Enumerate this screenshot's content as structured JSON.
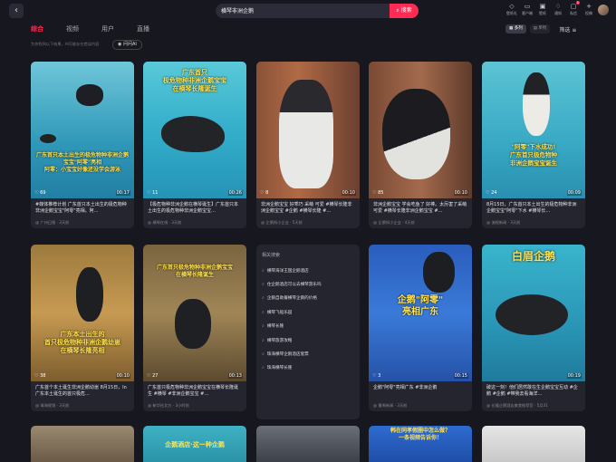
{
  "search": {
    "query": "横琴非洲企鹅",
    "button": "搜索"
  },
  "toolbar": [
    {
      "icon": "diamond-icon",
      "label": "壁纸礼"
    },
    {
      "icon": "devices-icon",
      "label": "客户端"
    },
    {
      "icon": "desktop-icon",
      "label": "壁纸"
    },
    {
      "icon": "notify-icon",
      "label": "通知"
    },
    {
      "icon": "message-icon",
      "label": "私信",
      "badge": "1"
    },
    {
      "icon": "upload-icon",
      "label": "投稿"
    }
  ],
  "tabs": [
    "综合",
    "视频",
    "用户",
    "直播"
  ],
  "hint": "为你找到以下结果，AI可能存在错误内容",
  "ai_chip": "问问AI",
  "views": {
    "list": "多列",
    "single": "单列",
    "filter": "筛选"
  },
  "accent": "#fe2c55",
  "cards": [
    {
      "caption": "广东首只本土出生的极危物种非洲企鹅宝宝\"阿零\"亮相\n阿零：小宝宝好像还没学会游泳",
      "likes": "69",
      "duration": "00:17",
      "title": "#媒体推荐计划 广东首只本土出生的极危物种非洲企鹅宝宝\"阿零\"亮相。阿…",
      "author": "广州日报",
      "date": "3天前"
    },
    {
      "caption": "广东首只\n极危物种非洲企鹅宝宝\n在横琴长隆诞生",
      "likes": "11",
      "duration": "00:26",
      "title": "【极危物种非洲企鹅在横琴诞生】广东首只本土出生的极危物种非洲企鹅宝宝…",
      "author": "横琴在线",
      "date": "3天前"
    },
    {
      "caption": "",
      "likes": "8",
      "duration": "00:10",
      "title": "非洲企鹅宝宝 好乖巧 采萌 可爱 #横琴长隆非洲企鹅宝宝 #企鹅 #横琴长隆 #…",
      "author": "企鹅知小企业",
      "date": "5天前"
    },
    {
      "caption": "",
      "likes": "85",
      "duration": "00:10",
      "title": "非洲企鹅宝宝 学会吃鱼了 好棒。太厉害了采萌 可爱 #横琴长隆非洲企鹅宝宝 #…",
      "author": "企鹅知小企业",
      "date": "4天前"
    },
    {
      "caption": "\"阿零\"下水成功!\n广东首只极危物种\n非洲企鹅宝宝诞生",
      "likes": "24",
      "duration": "00:09",
      "title": "8月15日，广东首只本土出生的极危物种非洲企鹅宝宝\"阿零\"下水 #横琴长…",
      "author": "澳视新闻",
      "date": "3天前"
    },
    {
      "caption": "广东本土出生的\n首只极危物种非洲企鹅幼崽\n在横琴长隆亮相",
      "likes": "38",
      "duration": "00:10",
      "title": "广东首个本土诞生非洲企鹅幼崽 8月15日，In广东本土诞生的首只极危…",
      "author": "珠海视频",
      "date": "3天前"
    },
    {
      "caption": "广东首只极危物种非洲企鹅宝宝\n在横琴长隆诞生",
      "likes": "27",
      "duration": "00:13",
      "title": "广东首只极危物种非洲企鹅宝宝在横琴长隆诞生 #横琴 #非洲企鹅宝宝 #…",
      "author": "新华社北方",
      "date": "3小时前"
    },
    {
      "caption": "企鹅\"阿零\"\n亮相广东",
      "likes": "3",
      "duration": "00:15",
      "title": "企鹅\"阿零\"亮相广东 #非洲企鹅",
      "author": "番禺新闻",
      "date": "3天前"
    },
    {
      "caption": "白眉企鹅",
      "likes": "",
      "duration": "00:19",
      "title": "破这一刻！他们居然敢在生企鹅宝宝互动 #企鹅 #企鹅 #带我去看海洋…",
      "author": "长隆企鹅酒店美食推荐官",
      "date": "5月31"
    }
  ],
  "related": {
    "heading": "相关搜索",
    "items": [
      "横琴海洋王国企鹅酒店",
      "住企鹅酒店可以去横琴游乐吗",
      "企鹅自助餐横琴企鹅的价格",
      "横琴飞船乐园",
      "横琴长隆",
      "横琴旅游攻略",
      "珠海横琴企鹅酒店套票",
      "珠海横琴长隆"
    ]
  },
  "bottom": {
    "c2": "企鹅酒店·这一种企鹅",
    "c4": "韩在同孝假圈中怎么做？\n一条视频告诉你！"
  }
}
